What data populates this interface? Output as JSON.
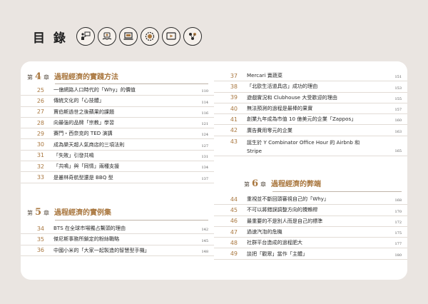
{
  "toc": {
    "title": "目 錄",
    "icons": [
      "presenter-icon",
      "money-hands-icon",
      "laptop-icon",
      "coin-gear-icon",
      "play-video-icon",
      "people-network-icon"
    ]
  },
  "accent_color": "#a9773f",
  "chapters": [
    {
      "prefix": "第",
      "num": "4",
      "suffix": "章",
      "title": "過程經濟的實踐方法",
      "entries": [
        {
          "num": "25",
          "title": "一億網路人口時代的「Why」的價值",
          "page": "110"
        },
        {
          "num": "26",
          "title": "傳統文化的「心技體」",
          "page": "114"
        },
        {
          "num": "27",
          "title": "賈伯斯過世之後蘋果的課題",
          "page": "116"
        },
        {
          "num": "28",
          "title": "向最強的品牌「宗教」學習",
          "page": "121"
        },
        {
          "num": "29",
          "title": "賽門・西奈克的 TED 演講",
          "page": "124"
        },
        {
          "num": "30",
          "title": "成為樂天超人氣商店的三項法則",
          "page": "127"
        },
        {
          "num": "31",
          "title": "「失敗」引發共鳴",
          "page": "131"
        },
        {
          "num": "32",
          "title": "「共鳴」與「同情」兩種支援",
          "page": "134"
        },
        {
          "num": "33",
          "title": "是叢林奇航型還是 BBQ 型",
          "page": "137"
        }
      ]
    },
    {
      "prefix": "第",
      "num": "5",
      "suffix": "章",
      "title": "過程經濟的實例集",
      "entries": [
        {
          "num": "34",
          "title": "BTS 在全球市場獨占鰲頭的理由",
          "page": "142"
        },
        {
          "num": "35",
          "title": "傑尼斯事務所鎖定的粉絲戰略",
          "page": "145"
        },
        {
          "num": "36",
          "title": "中國小米的「大家一起製造的智慧型手機」",
          "page": "148"
        }
      ]
    },
    {
      "entries": [
        {
          "num": "37",
          "title": "Mercari 賣蔬菜",
          "page": "151"
        },
        {
          "num": "38",
          "title": "「北歐生活道具店」成功的理由",
          "page": "153"
        },
        {
          "num": "39",
          "title": "遊戲實況和 Clubhouse 大受歡迎的理由",
          "page": "155"
        },
        {
          "num": "40",
          "title": "無法預測的過程是最棒的果實",
          "page": "157"
        },
        {
          "num": "41",
          "title": "創業九年成為市值 10 億美元的企業「Zappos」",
          "page": "160"
        },
        {
          "num": "42",
          "title": "廣告費用零元的企業",
          "page": "163"
        },
        {
          "num": "43",
          "title": "誕生於 Y Combinator Office Hour 的 Airbnb 和 Stripe",
          "page": "165"
        }
      ]
    },
    {
      "prefix": "第",
      "num": "6",
      "suffix": "章",
      "title": "過程經濟的弊端",
      "entries": [
        {
          "num": "44",
          "title": "重視並不斷回頭審視自己的「Why」",
          "page": "168"
        },
        {
          "num": "45",
          "title": "不可以將錯誤調整方向的攪賴桿",
          "page": "170"
        },
        {
          "num": "46",
          "title": "最重要的不是別人而是自己的標準",
          "page": "172"
        },
        {
          "num": "47",
          "title": "過速汽泡的危機",
          "page": "175"
        },
        {
          "num": "48",
          "title": "社群平台造成的過程肥大",
          "page": "177"
        },
        {
          "num": "49",
          "title": "談把「觀眾」當作「主體」",
          "page": "180"
        }
      ]
    }
  ]
}
